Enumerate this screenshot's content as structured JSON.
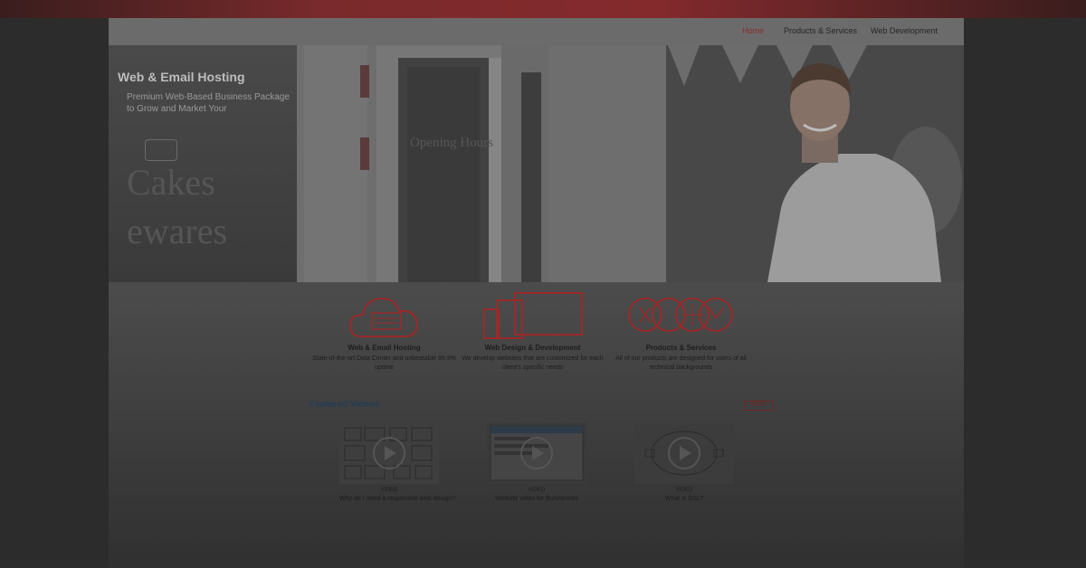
{
  "nav": {
    "items": [
      {
        "label": "Home",
        "active": true
      },
      {
        "label": "Products & Services",
        "active": false
      },
      {
        "label": "Web Development",
        "active": false
      }
    ]
  },
  "hero": {
    "title": "Web & Email Hosting",
    "subtitle": "Premium Web-Based Business Package to Grow and Market Your",
    "photo_text": [
      "Opening Hours",
      "ewares",
      "Cakes"
    ]
  },
  "features": [
    {
      "icon": "cloud-server-icon",
      "title": "Web & Email Hosting",
      "description": "State-of-the-art Data Center and unbeatable 99.9% uptime"
    },
    {
      "icon": "devices-icon",
      "title": "Web Design & Development",
      "description": "We develop websites that are customized for each client's specific needs"
    },
    {
      "icon": "product-logos-icon",
      "title": "Products & Services",
      "description": "All of our products are designed for users of all technical backgrounds"
    }
  ],
  "featured_videos": {
    "title": "Featured Videos",
    "more_label": "MORE",
    "videos": [
      {
        "source": "VIDEO",
        "caption": "Why do I need a responsive web design?"
      },
      {
        "source": "VIDEO",
        "caption": "Website video for Businesses"
      },
      {
        "source": "VIDEO",
        "caption": "What is SSL?"
      }
    ]
  },
  "colors": {
    "accent": "#c0282c",
    "link": "#1e88e5",
    "topbar": "#842a2d"
  }
}
